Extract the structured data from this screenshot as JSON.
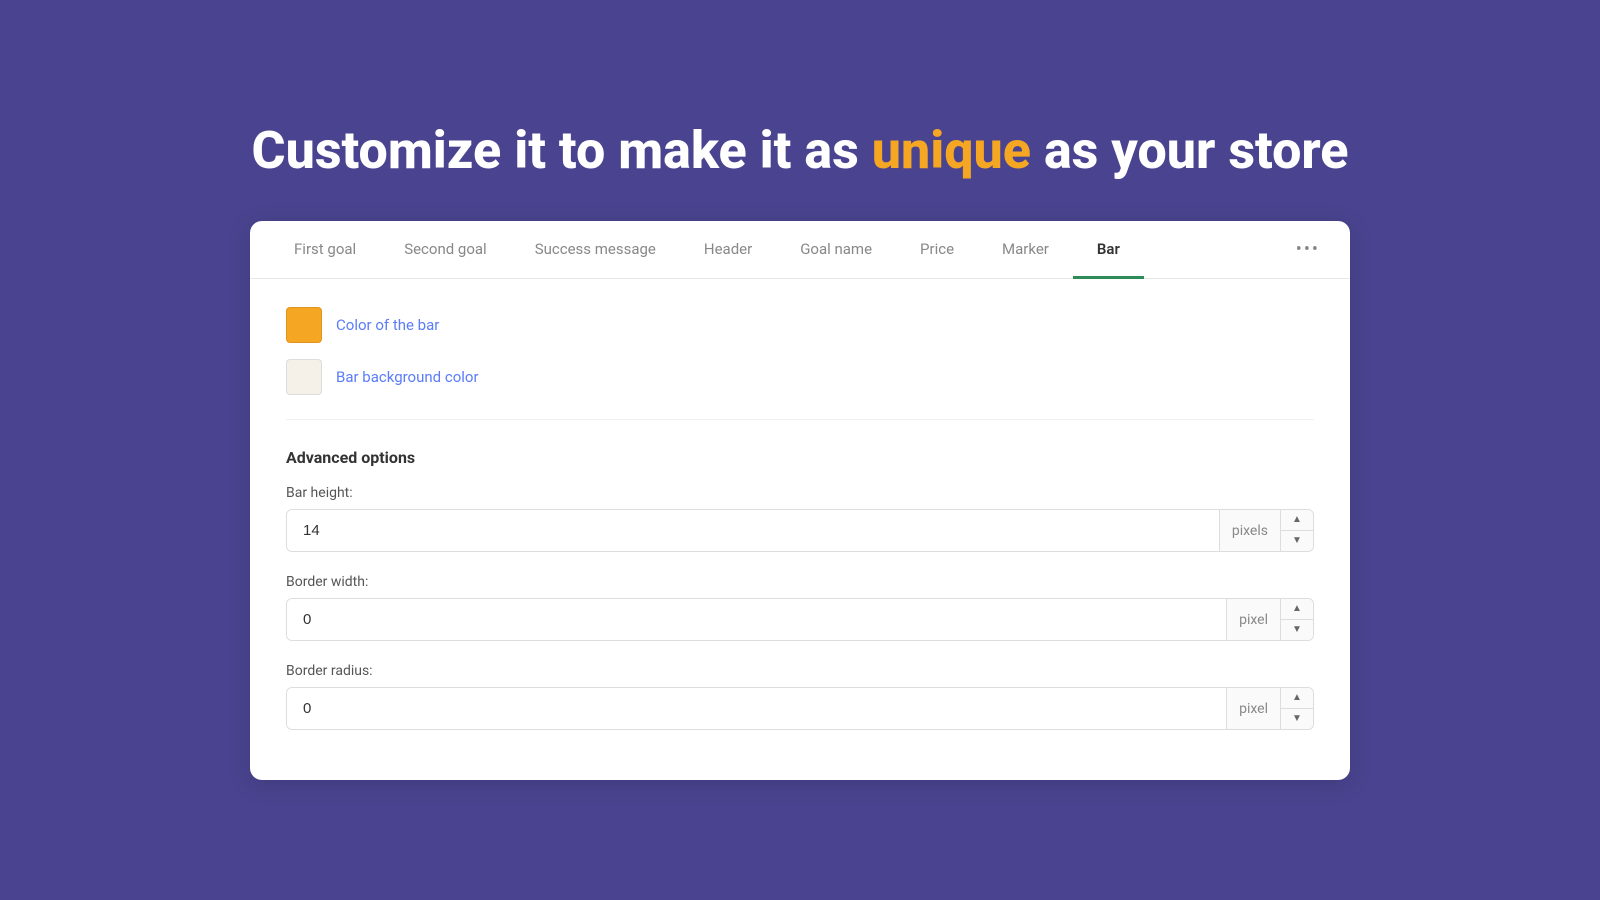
{
  "headline": {
    "prefix": "Customize it to make it as ",
    "highlight": "unique",
    "suffix": " as your store"
  },
  "tabs": {
    "items": [
      {
        "id": "first-goal",
        "label": "First goal",
        "active": false
      },
      {
        "id": "second-goal",
        "label": "Second goal",
        "active": false
      },
      {
        "id": "success-message",
        "label": "Success message",
        "active": false
      },
      {
        "id": "header",
        "label": "Header",
        "active": false
      },
      {
        "id": "goal-name",
        "label": "Goal name",
        "active": false
      },
      {
        "id": "price",
        "label": "Price",
        "active": false
      },
      {
        "id": "marker",
        "label": "Marker",
        "active": false
      },
      {
        "id": "bar",
        "label": "Bar",
        "active": true
      }
    ],
    "more_label": "•••"
  },
  "colors": {
    "bar_color_label": "Color of the bar",
    "bar_bg_color_label": "Bar background color",
    "bar_color_value": "#f5a623",
    "bar_bg_color_value": "#f5f0e8"
  },
  "advanced": {
    "title": "Advanced options",
    "fields": [
      {
        "id": "bar-height",
        "label": "Bar height:",
        "value": "14",
        "unit": "pixels"
      },
      {
        "id": "border-width",
        "label": "Border width:",
        "value": "0",
        "unit": "pixel"
      },
      {
        "id": "border-radius",
        "label": "Border radius:",
        "value": "0",
        "unit": "pixel"
      }
    ]
  }
}
